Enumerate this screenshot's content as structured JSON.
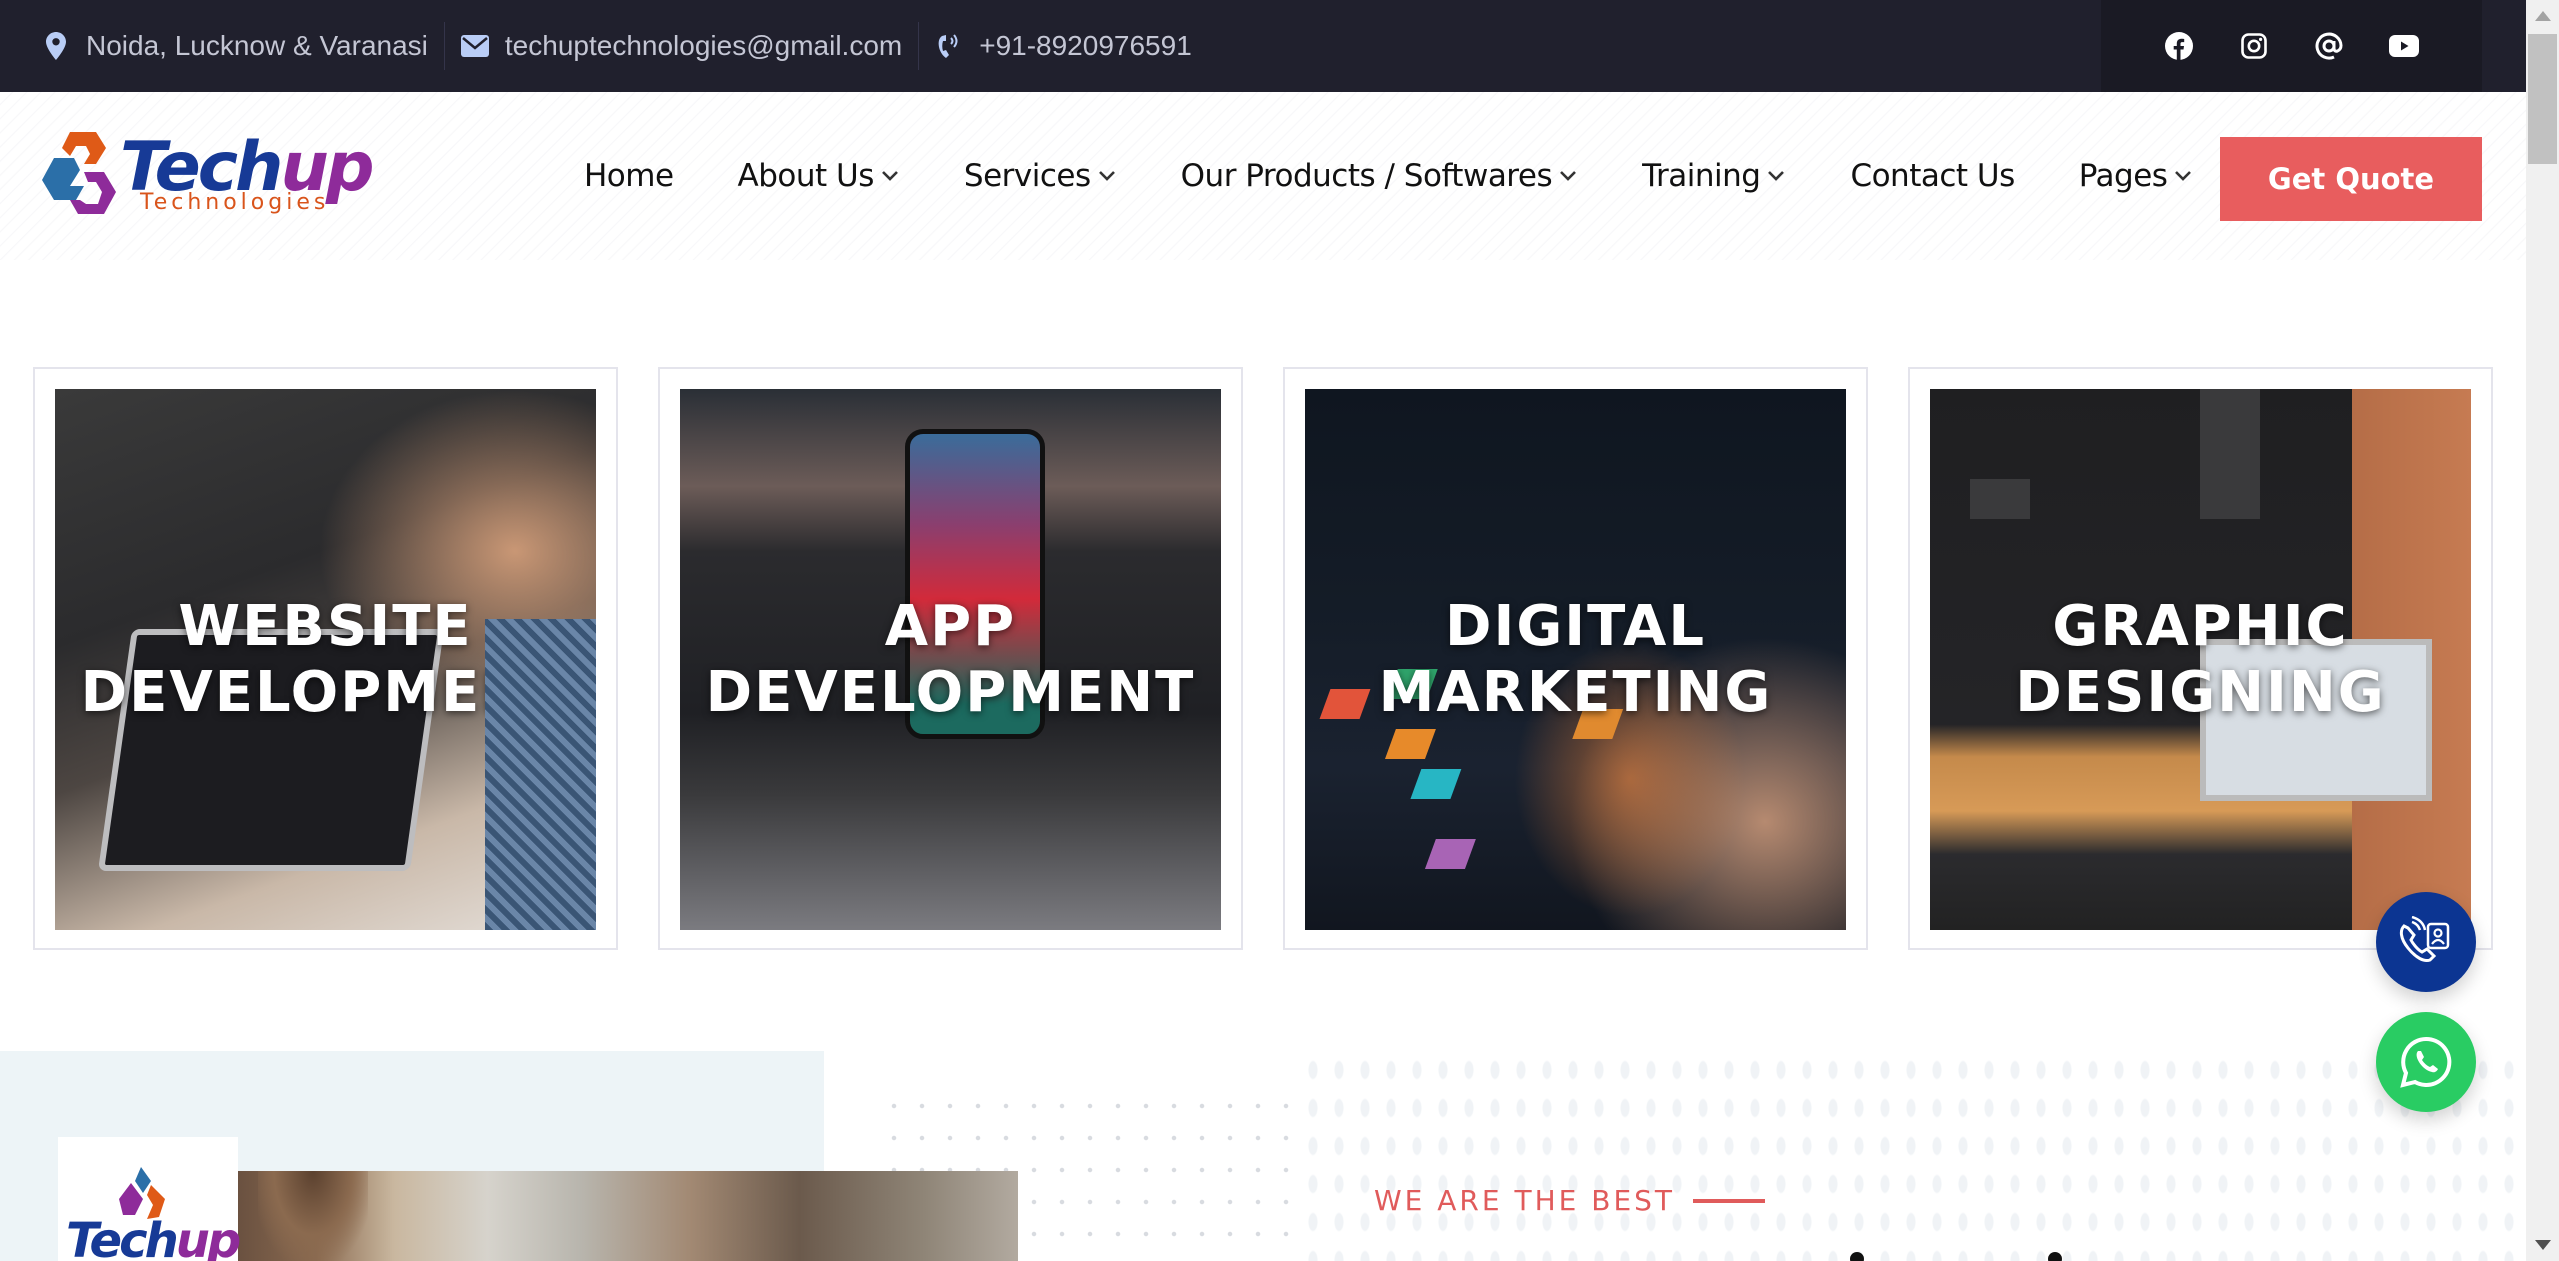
{
  "topbar": {
    "location": {
      "icon": "map-pin-icon",
      "text": "Noida, Lucknow & Varanasi"
    },
    "email": {
      "icon": "envelope-icon",
      "text": "techuptechnologies@gmail.com"
    },
    "phone": {
      "icon": "phone-icon",
      "text": "+91-8920976591"
    },
    "social": [
      {
        "name": "facebook",
        "icon": "facebook-icon"
      },
      {
        "name": "instagram",
        "icon": "instagram-icon"
      },
      {
        "name": "threads",
        "icon": "at-sign-icon"
      },
      {
        "name": "youtube",
        "icon": "youtube-icon"
      }
    ]
  },
  "header": {
    "logo": {
      "brand_primary": "Tech",
      "brand_accent": "up",
      "subtitle": "Technologies"
    },
    "nav": [
      {
        "label": "Home",
        "dropdown": false
      },
      {
        "label": "About Us",
        "dropdown": true
      },
      {
        "label": "Services",
        "dropdown": true
      },
      {
        "label": "Our Products / Softwares",
        "dropdown": true
      },
      {
        "label": "Training",
        "dropdown": true
      },
      {
        "label": "Contact Us",
        "dropdown": false
      },
      {
        "label": "Pages",
        "dropdown": true
      }
    ],
    "cta_label": "Get Quote"
  },
  "services": [
    {
      "line1": "WEBSITE",
      "line2": "DEVELOPMENT"
    },
    {
      "line1": "APP",
      "line2": "DEVELOPMENT"
    },
    {
      "line1": "DIGITAL",
      "line2": "MARKETING"
    },
    {
      "line1": "GRAPHIC",
      "line2": "DESIGNING"
    }
  ],
  "about": {
    "logo_text_primary": "Tech",
    "logo_text_accent": "up",
    "eyebrow": "WE ARE THE BEST"
  },
  "floating": {
    "call_icon": "phone-contact-icon",
    "whatsapp_icon": "whatsapp-icon"
  },
  "colors": {
    "topbar_bg": "#20202d",
    "accent": "#e85d5e",
    "brand_blue": "#173a96",
    "brand_purple": "#8e2b9a",
    "brand_orange": "#d9541b",
    "call_button": "#0c3592",
    "whatsapp_button": "#29cc63"
  }
}
